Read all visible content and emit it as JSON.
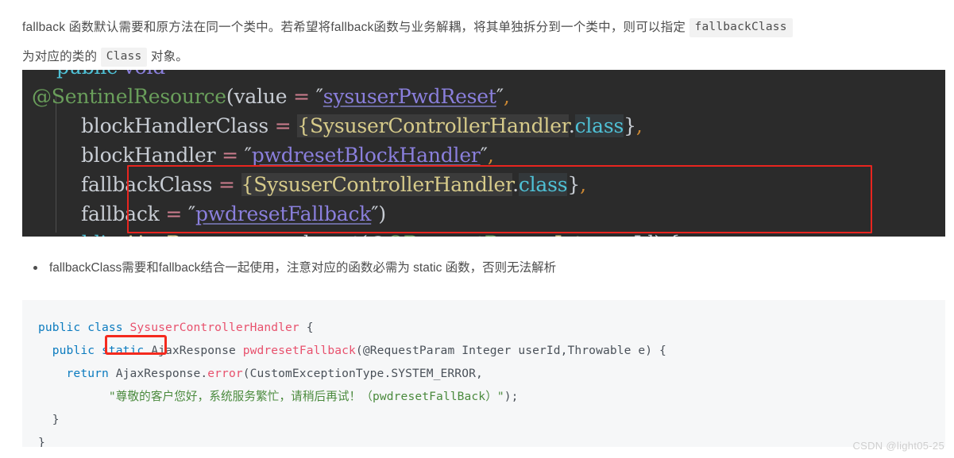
{
  "intro": {
    "line1_a": "fallback 函数默认需要和原方法在同一个类中。若希望将fallback函数与业务解耦，将其单独拆分到一个类中，则可以指定 ",
    "chip1": "fallbackClass",
    "line2_a": "为对应的类的 ",
    "chip2": "Class",
    "line2_b": " 对象。"
  },
  "dark_code": {
    "lines": [
      {
        "id": "partial-top",
        "tokens": [
          {
            "t": "    public ",
            "c": "d-blue"
          },
          {
            "t": "void",
            "c": "d-purp"
          }
        ]
      },
      {
        "id": "annotation",
        "tokens": [
          {
            "t": "@SentinelResource",
            "c": "d-ann"
          },
          {
            "t": "(",
            "c": "d-txt"
          },
          {
            "t": "value",
            "c": "d-txt"
          },
          {
            "t": " = ",
            "c": "d-op"
          },
          {
            "t": "″",
            "c": "d-quote"
          },
          {
            "t": "sysuserPwdReset",
            "c": "d-str"
          },
          {
            "t": "″",
            "c": "d-quote"
          },
          {
            "t": ",",
            "c": "d-comma"
          }
        ]
      },
      {
        "id": "block-handler-class",
        "tokens": [
          {
            "t": "        blockHandlerClass",
            "c": "d-txt"
          },
          {
            "t": " = ",
            "c": "d-op"
          },
          {
            "t": "{",
            "c": "d-cls"
          },
          {
            "t": "SysuserControllerHandler",
            "c": "d-cls"
          },
          {
            "t": ".",
            "c": "d-txt"
          },
          {
            "t": "class",
            "c": "d-kw"
          },
          {
            "t": "}",
            "c": "d-txt"
          },
          {
            "t": ",",
            "c": "d-comma"
          }
        ]
      },
      {
        "id": "block-handler",
        "tokens": [
          {
            "t": "        blockHandler",
            "c": "d-txt"
          },
          {
            "t": " = ",
            "c": "d-op"
          },
          {
            "t": "″",
            "c": "d-quote"
          },
          {
            "t": "pwdresetBlockHandler",
            "c": "d-str"
          },
          {
            "t": "″",
            "c": "d-quote"
          },
          {
            "t": ",",
            "c": "d-comma"
          }
        ]
      },
      {
        "id": "fallback-class",
        "tokens": [
          {
            "t": "        fallbackClass",
            "c": "d-txt"
          },
          {
            "t": " = ",
            "c": "d-op"
          },
          {
            "t": "{",
            "c": "d-cls"
          },
          {
            "t": "SysuserControllerHandler",
            "c": "d-cls"
          },
          {
            "t": ".",
            "c": "d-txt"
          },
          {
            "t": "class",
            "c": "d-kw"
          },
          {
            "t": "}",
            "c": "d-txt"
          },
          {
            "t": ",",
            "c": "d-comma"
          }
        ]
      },
      {
        "id": "fallback",
        "tokens": [
          {
            "t": "        fallback",
            "c": "d-txt"
          },
          {
            "t": " = ",
            "c": "d-op"
          },
          {
            "t": "″",
            "c": "d-quote"
          },
          {
            "t": "pwdresetFallback",
            "c": "d-str"
          },
          {
            "t": "″",
            "c": "d-quote"
          },
          {
            "t": ")",
            "c": "d-txt"
          }
        ]
      },
      {
        "id": "partial-bottom",
        "tokens": [
          {
            "t": "    public ",
            "c": "d-blue"
          },
          {
            "t": "AjaxResponse",
            "c": "d-yel"
          },
          {
            "t": " pwdreset",
            "c": "d-txt"
          },
          {
            "t": "(@",
            "c": "d-txt"
          },
          {
            "t": "QRequestParam",
            "c": "d-grn"
          },
          {
            "t": " Integer",
            "c": "d-yel"
          },
          {
            "t": " Id",
            "c": "d-txt"
          },
          {
            "t": ") {",
            "c": "d-txt"
          }
        ]
      }
    ],
    "highlight_box_label": "fallbackClass-and-fallback-highlight"
  },
  "bullet": {
    "text": "fallbackClass需要和fallback结合一起使用，注意对应的函数必需为 static 函数，否则无法解析"
  },
  "light_code": {
    "lines": [
      {
        "id": "class-decl",
        "tokens": [
          {
            "t": "public class ",
            "c": "l-kw"
          },
          {
            "t": "SysuserControllerHandler",
            "c": "l-cls"
          },
          {
            "t": " {",
            "c": "l-txt"
          }
        ]
      },
      {
        "id": "method-decl",
        "tokens": [
          {
            "t": "  public ",
            "c": "l-kw"
          },
          {
            "t": "static ",
            "c": "l-kw"
          },
          {
            "t": "AjaxResponse ",
            "c": "l-txt"
          },
          {
            "t": "pwdresetFallback",
            "c": "l-fn"
          },
          {
            "t": "(",
            "c": "l-txt"
          },
          {
            "t": "@RequestParam",
            "c": "l-ann"
          },
          {
            "t": " Integer userId,Throwable e) {",
            "c": "l-txt"
          }
        ]
      },
      {
        "id": "return-stmt",
        "tokens": [
          {
            "t": "    return ",
            "c": "l-kw"
          },
          {
            "t": "AjaxResponse.",
            "c": "l-txt"
          },
          {
            "t": "error",
            "c": "l-fn"
          },
          {
            "t": "(CustomExceptionType.SYSTEM_ERROR,",
            "c": "l-txt"
          }
        ]
      },
      {
        "id": "string-arg",
        "tokens": [
          {
            "t": "          \"尊敬的客户您好，系统服务繁忙，请稍后再试！（pwdresetFallBack）\"",
            "c": "l-str"
          },
          {
            "t": ");",
            "c": "l-txt"
          }
        ]
      },
      {
        "id": "close-method",
        "tokens": [
          {
            "t": "  }",
            "c": "l-txt"
          }
        ]
      },
      {
        "id": "close-class",
        "tokens": [
          {
            "t": "}",
            "c": "l-txt"
          }
        ]
      }
    ],
    "static_box_label": "static-keyword-highlight"
  },
  "watermark": {
    "text": "CSDN @light05-25"
  },
  "colors": {
    "dark_bg": "#2b2b2b",
    "light_bg": "#f6f7f8",
    "red_box": "#e8251f",
    "chip_bg": "#f2f2f2",
    "body_text": "#4d4d4d"
  }
}
